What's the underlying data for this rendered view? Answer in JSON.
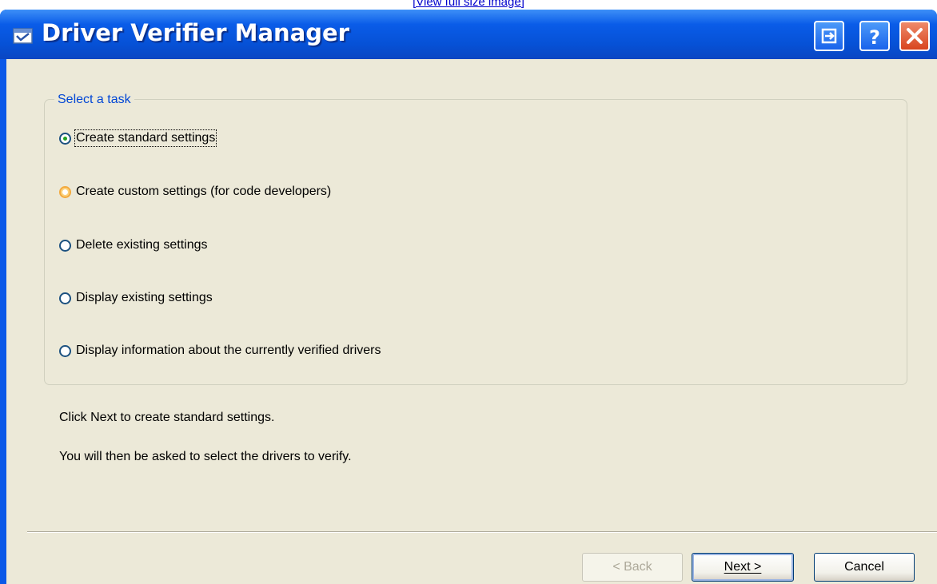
{
  "page": {
    "top_link": "[View full size image]"
  },
  "window": {
    "title": "Driver Verifier Manager",
    "icons": {
      "app": "driver-verifier-icon",
      "context_help": "help-icon",
      "close": "close-icon",
      "extra": "window-minimize-icon"
    }
  },
  "group": {
    "legend": "Select a task",
    "options": [
      {
        "label": "Create standard settings",
        "selected": true,
        "focused": true
      },
      {
        "label": "Create custom settings (for code developers)",
        "selected": false,
        "hovered": true
      },
      {
        "label": "Delete existing settings",
        "selected": false
      },
      {
        "label": "Display existing settings",
        "selected": false
      },
      {
        "label": "Display information about the currently verified drivers",
        "selected": false
      }
    ]
  },
  "description": {
    "line1": "Click Next to create standard settings.",
    "line2": "You will then be asked to select the drivers to verify."
  },
  "buttons": {
    "back": "< Back",
    "next": "Next >",
    "cancel": "Cancel"
  },
  "colors": {
    "titlebar": "#0a5ce8",
    "dialog_bg": "#ece9d8",
    "legend": "#0046d5",
    "close_btn": "#d8451f",
    "radio_selected_dot": "#21a121",
    "radio_hover": "#f3a93c"
  }
}
